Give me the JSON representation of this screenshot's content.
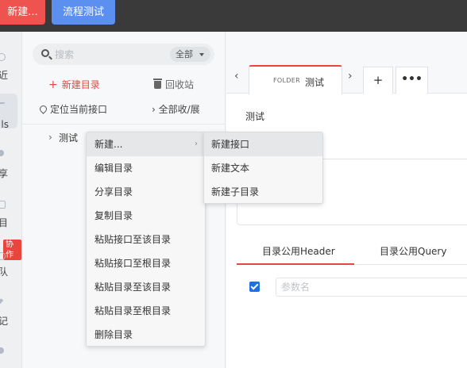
{
  "topbar": {
    "new_label": "新建...",
    "flow_test_label": "流程测试",
    "new_color": "#ef5350",
    "flow_color": "#5b8ff0"
  },
  "leftnav": {
    "items": [
      {
        "label": "近",
        "icon": "clock-icon"
      },
      {
        "label": "ls",
        "icon": "api-icon"
      },
      {
        "label": "享",
        "icon": "share-icon"
      },
      {
        "label": "目",
        "icon": "folder-icon"
      },
      {
        "label": "队",
        "icon": "team-icon"
      },
      {
        "label": "记",
        "icon": "note-icon"
      }
    ],
    "collab_badge": "协作"
  },
  "sidebar": {
    "search_placeholder": "搜索",
    "scope_label": "全部",
    "add_dir_label": "新建目录",
    "recycle_label": "回收站",
    "locate_label": "定位当前接口",
    "expand_all_label": "全部收/展",
    "tree": [
      {
        "label": "测试"
      }
    ]
  },
  "tabs": {
    "active": {
      "type": "FOLDER",
      "name": "测试"
    },
    "add": "+",
    "more": "•••"
  },
  "main": {
    "title": "测试",
    "subtabs": [
      "目录公用Header",
      "目录公用Query"
    ],
    "param_placeholder": "参数名"
  },
  "context_menu": {
    "items": [
      "新建...",
      "编辑目录",
      "分享目录",
      "复制目录",
      "粘贴接口至该目录",
      "粘贴接口至根目录",
      "粘贴目录至该目录",
      "粘贴目录至根目录",
      "删除目录"
    ],
    "submenu": [
      "新建接口",
      "新建文本",
      "新建子目录"
    ]
  },
  "accent_color": "#e8453c"
}
